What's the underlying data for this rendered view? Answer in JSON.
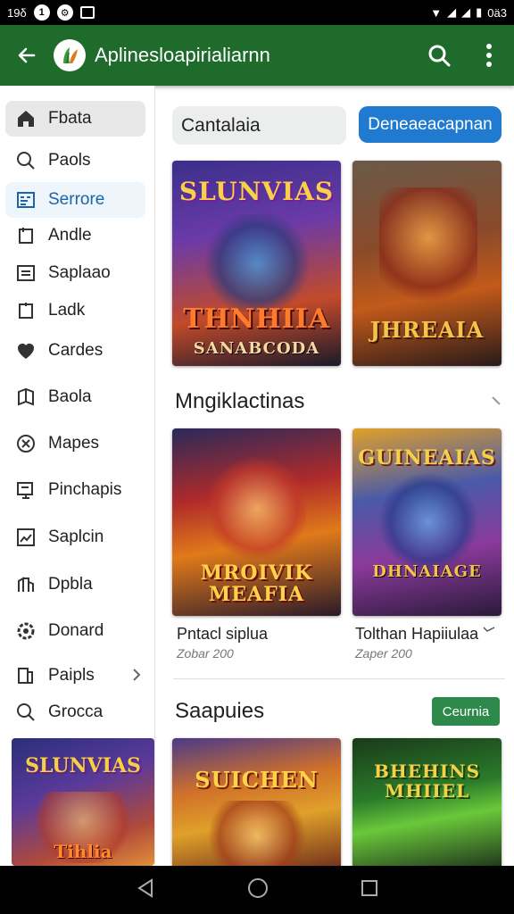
{
  "status_bar": {
    "left_text": "19δ",
    "right_text": "0ä3"
  },
  "app_bar": {
    "title": "Aplinesloapirialiarnn",
    "brand_color": "#1e6b2c"
  },
  "sidebar": {
    "items": [
      {
        "label": "Fbata",
        "icon": "home-icon"
      },
      {
        "label": "Paols",
        "icon": "search-icon"
      },
      {
        "label": "Serrore",
        "icon": "list-box-icon"
      },
      {
        "label": "Andle",
        "icon": "bookmark-icon"
      },
      {
        "label": "Saplaao",
        "icon": "doc-icon"
      },
      {
        "label": "Ladk",
        "icon": "tag-icon"
      },
      {
        "label": "Cardes",
        "icon": "heart-icon"
      },
      {
        "label": "Baola",
        "icon": "book-icon"
      },
      {
        "label": "Mapes",
        "icon": "map-icon"
      },
      {
        "label": "Pinchapis",
        "icon": "monitor-icon"
      },
      {
        "label": "Saplcin",
        "icon": "image-icon"
      },
      {
        "label": "Dpbla",
        "icon": "building-icon"
      },
      {
        "label": "Donard",
        "icon": "settings-icon"
      },
      {
        "label": "Paipls",
        "icon": "device-icon"
      },
      {
        "label": "Grocca",
        "icon": "search-icon"
      }
    ],
    "banner_text": "Tihlia"
  },
  "main": {
    "search_value": "Cantalaia",
    "cta_label": "Deneaeacapnan",
    "top_cards": [
      {
        "title_top": "SLUNVIAS",
        "title_mid": "THNHIIA",
        "title_bot": "SANABCODA"
      },
      {
        "title_top": "",
        "title_mid": "JHREAIA",
        "title_bot": ""
      }
    ],
    "section1": {
      "title": "Mngiklactinas",
      "cards": [
        {
          "art_top": "",
          "art_title": "MROIVIK MEAFIA",
          "caption": "Pntacl siplua",
          "sub": "Zobar 200"
        },
        {
          "art_top": "GUINEAIAS",
          "art_title": "DHNAIAGE",
          "caption": "Tolthan Hapiiulaa",
          "sub": "Zaper 200"
        }
      ]
    },
    "section2": {
      "title": "Saapuies",
      "button_label": "Ceurnia",
      "cards": [
        {
          "art_title": "SUICHEN"
        },
        {
          "art_title": "BHEHINS MHIIEL"
        }
      ]
    }
  },
  "colors": {
    "accent_blue": "#1f7ad0",
    "accent_green": "#2e8a4b"
  }
}
